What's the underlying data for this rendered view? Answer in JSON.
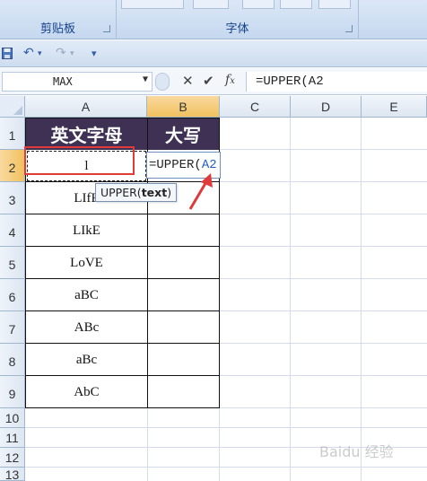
{
  "ribbon": {
    "groups": [
      {
        "label": "剪贴板"
      },
      {
        "label": "字体"
      }
    ]
  },
  "qat": {
    "save_icon": "save-icon",
    "undo_icon": "undo-icon",
    "redo_icon": "redo-icon",
    "customize_icon": "customize-qat-icon"
  },
  "formula_bar": {
    "name_box": "MAX",
    "formula": "=UPPER(A2"
  },
  "columns": [
    "A",
    "B",
    "C",
    "D",
    "E"
  ],
  "rows": [
    "1",
    "2",
    "3",
    "4",
    "5",
    "6",
    "7",
    "8",
    "9",
    "10",
    "11",
    "12",
    "13"
  ],
  "table": {
    "header": [
      "英文字母",
      "大写"
    ],
    "a_values": [
      "l",
      "LIfE",
      "LIkE",
      "LoVE",
      "aBC",
      "ABc",
      "aBc",
      "AbC"
    ]
  },
  "editing": {
    "prefix": "=UPPER(",
    "ref": "A2"
  },
  "tooltip": {
    "fn": "UPPER(",
    "arg": "text",
    "close": ")"
  },
  "colors": {
    "header_fill": "#3e3153",
    "highlight_red": "#e03a3a",
    "ref_blue": "#1f5ec4"
  }
}
